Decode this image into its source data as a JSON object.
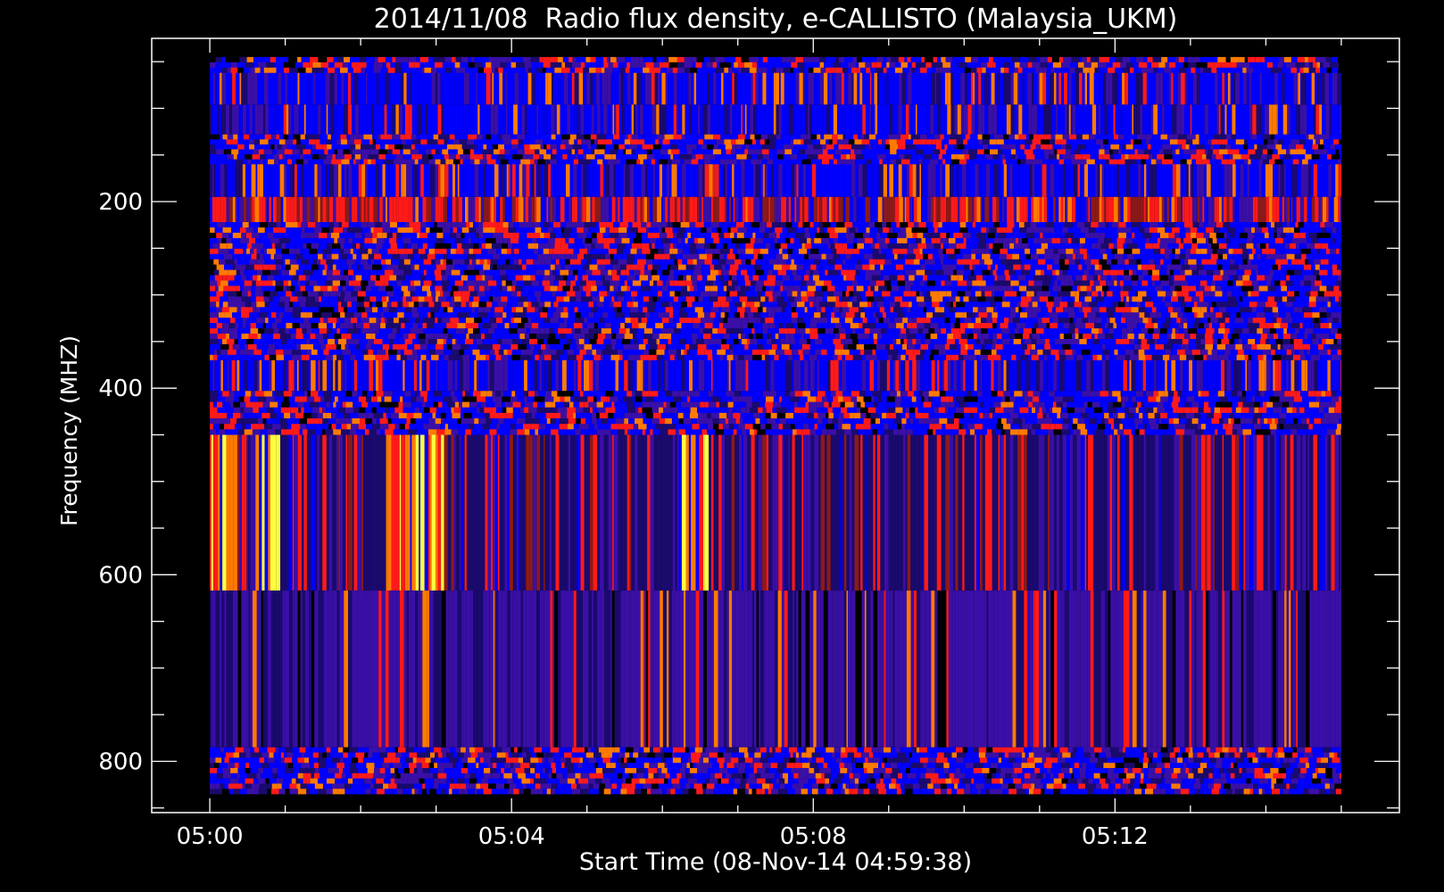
{
  "chart_data": {
    "type": "heatmap",
    "title": "2014/11/08  Radio flux density, e-CALLISTO (Malaysia_UKM)",
    "xlabel": "Start Time (08-Nov-14 04:59:38)",
    "ylabel": "Frequency (MHZ)",
    "x_ticks": [
      "05:00",
      "05:04",
      "05:08",
      "05:12"
    ],
    "x_tick_minutes": [
      0,
      4,
      8,
      12
    ],
    "x_range_minutes": [
      -0.77,
      15.77
    ],
    "data_x_range_minutes": [
      0,
      15
    ],
    "y_ticks": [
      200,
      400,
      600,
      800
    ],
    "y_range": [
      25,
      855
    ],
    "y_inverted": true,
    "data_y_range": [
      45,
      835
    ],
    "colormap": [
      "#000000",
      "#1a0a6e",
      "#3a0fa8",
      "#0000ff",
      "#8b1a1a",
      "#ff1a1a",
      "#ff7a00",
      "#ffff40"
    ],
    "bands": [
      {
        "from": 45,
        "to": 62,
        "style": "noise"
      },
      {
        "from": 62,
        "to": 96,
        "style": "blue-stripes"
      },
      {
        "from": 96,
        "to": 128,
        "style": "blue-stripes"
      },
      {
        "from": 128,
        "to": 160,
        "style": "noise"
      },
      {
        "from": 160,
        "to": 195,
        "style": "blue-stripes"
      },
      {
        "from": 195,
        "to": 222,
        "style": "red-stripes"
      },
      {
        "from": 222,
        "to": 370,
        "style": "noise"
      },
      {
        "from": 370,
        "to": 403,
        "style": "blue-stripes"
      },
      {
        "from": 403,
        "to": 450,
        "style": "noise"
      },
      {
        "from": 450,
        "to": 617,
        "style": "burst"
      },
      {
        "from": 617,
        "to": 785,
        "style": "purple-stripes"
      },
      {
        "from": 785,
        "to": 835,
        "style": "noise"
      }
    ],
    "bursts": [
      {
        "from_min": 0.0,
        "to_min": 0.35
      },
      {
        "from_min": 0.6,
        "to_min": 0.9
      },
      {
        "from_min": 2.3,
        "to_min": 3.1
      },
      {
        "from_min": 6.2,
        "to_min": 6.6
      }
    ],
    "grid": false
  }
}
